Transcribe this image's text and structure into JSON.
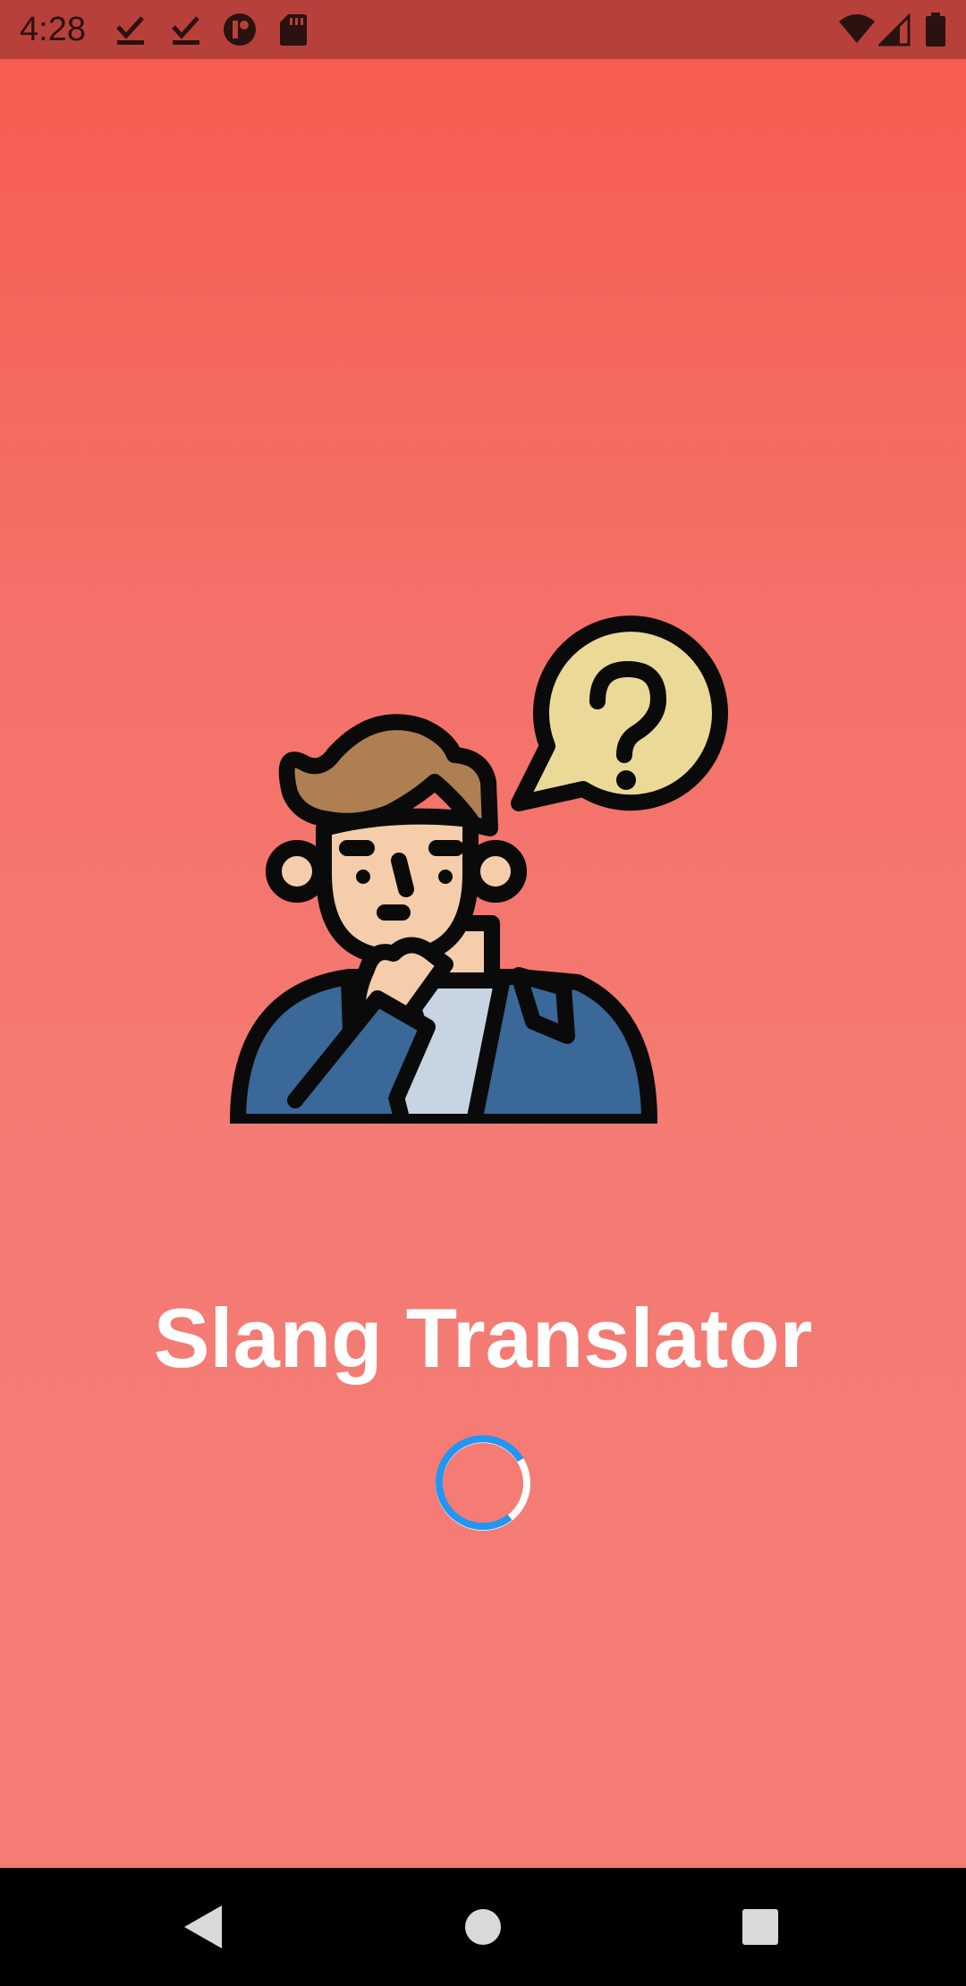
{
  "status_bar": {
    "time": "4:28",
    "icons": [
      "download-done-icon",
      "download-done-icon",
      "app-notification-icon",
      "sd-card-icon",
      "wifi-icon",
      "cellular-signal-icon",
      "battery-icon"
    ],
    "background": "#b8403a"
  },
  "splash": {
    "title": "Slang Translator",
    "illustration": "thinking-person-question-bubble",
    "spinner_color": "#2196f3",
    "background_top": "#f65c52",
    "background_bottom": "#f47c74"
  },
  "nav_bar": {
    "buttons": [
      "back-icon",
      "home-icon",
      "recents-icon"
    ]
  }
}
